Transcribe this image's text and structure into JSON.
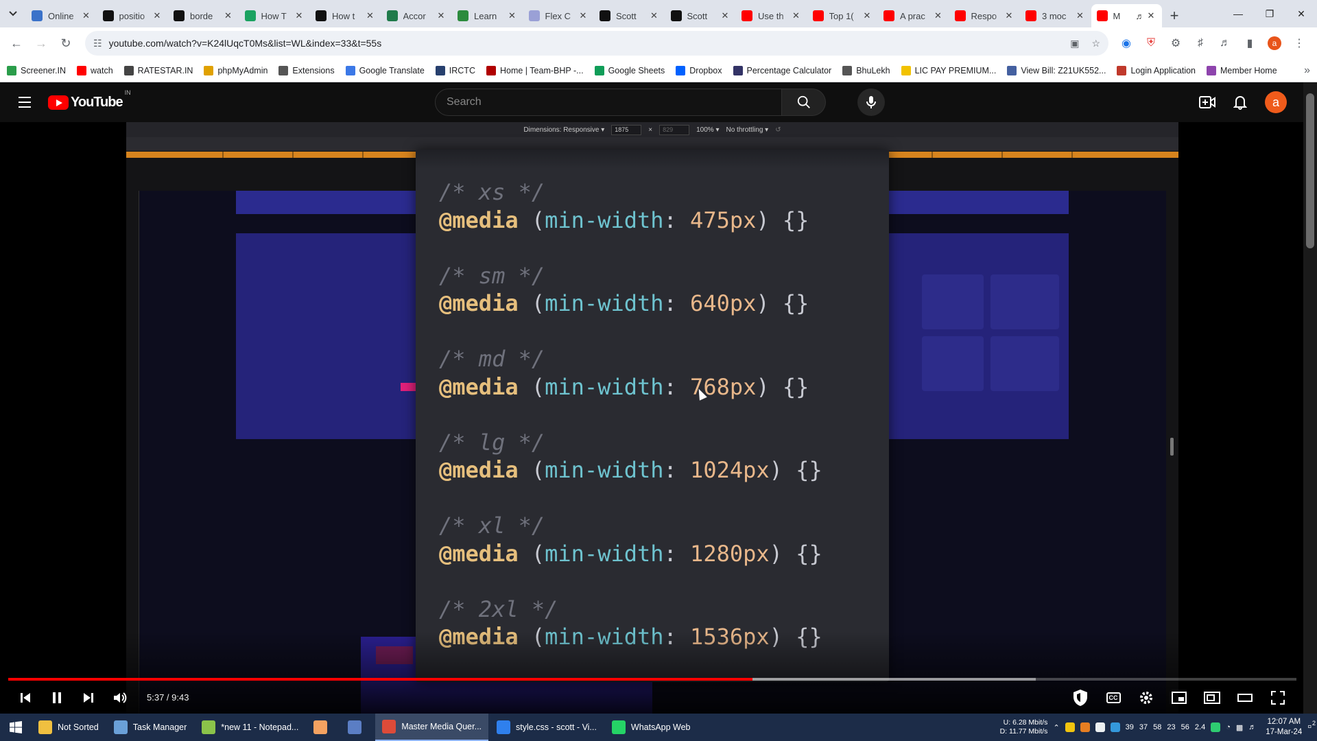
{
  "browser": {
    "tabs": [
      {
        "title": "Online",
        "color": "#3b72c9"
      },
      {
        "title": "positio",
        "color": "#111111"
      },
      {
        "title": "borde",
        "color": "#111111"
      },
      {
        "title": "How T",
        "color": "#1aa260"
      },
      {
        "title": "How t",
        "color": "#111111"
      },
      {
        "title": "Accor",
        "color": "#1f7a4a"
      },
      {
        "title": "Learn",
        "color": "#2c8b3e"
      },
      {
        "title": "Flex C",
        "color": "#9aa0d6"
      },
      {
        "title": "Scott",
        "color": "#111111"
      },
      {
        "title": "Scott",
        "color": "#111111"
      },
      {
        "title": "Use th",
        "color": "#ff0000"
      },
      {
        "title": "Top 1(",
        "color": "#ff0000"
      },
      {
        "title": "A prac",
        "color": "#ff0000"
      },
      {
        "title": "Respo",
        "color": "#ff0000"
      },
      {
        "title": "3 moc",
        "color": "#ff0000"
      },
      {
        "title": "M",
        "color": "#ff0000"
      }
    ],
    "url": "youtube.com/watch?v=K24lUqcT0Ms&list=WL&index=33&t=55s",
    "bookmarks": [
      {
        "label": "Screener.IN",
        "color": "#2a9d4a"
      },
      {
        "label": "watch",
        "color": "#ff0000"
      },
      {
        "label": "RATESTAR.IN",
        "color": "#444444"
      },
      {
        "label": "phpMyAdmin",
        "color": "#e0a100"
      },
      {
        "label": "Extensions",
        "color": "#555555"
      },
      {
        "label": "Google Translate",
        "color": "#3b78e7"
      },
      {
        "label": "IRCTC",
        "color": "#27406e"
      },
      {
        "label": "Home | Team-BHP -...",
        "color": "#b00000"
      },
      {
        "label": "Google Sheets",
        "color": "#0f9d58"
      },
      {
        "label": "Dropbox",
        "color": "#0061fe"
      },
      {
        "label": "Percentage Calculator",
        "color": "#333366"
      },
      {
        "label": "BhuLekh",
        "color": "#555555"
      },
      {
        "label": "LIC PAY PREMIUM...",
        "color": "#f2c200"
      },
      {
        "label": "View Bill: Z21UK552...",
        "color": "#4460a0"
      },
      {
        "label": "Login Application",
        "color": "#c0392b"
      },
      {
        "label": "Member Home",
        "color": "#8e44ad"
      }
    ]
  },
  "youtube": {
    "region": "IN",
    "logo_text": "YouTube",
    "search_placeholder": "Search",
    "avatar_letter": "a"
  },
  "video": {
    "devtools": {
      "dimensions_label": "Dimensions: Responsive ▾",
      "width": "1875",
      "times": "×",
      "height": "829",
      "zoom": "100% ▾",
      "throttle": "No throttling ▾"
    },
    "code_blocks": [
      {
        "comment": "/* xs */",
        "at": "@media",
        "open": " (",
        "prop": "min-width",
        "colon": ": ",
        "value": "475px",
        "close": ") {}"
      },
      {
        "comment": "/* sm */",
        "at": "@media",
        "open": " (",
        "prop": "min-width",
        "colon": ": ",
        "value": "640px",
        "close": ") {}"
      },
      {
        "comment": "/* md */",
        "at": "@media",
        "open": " (",
        "prop": "min-width",
        "colon": ": ",
        "value": "768px",
        "close": ") {}"
      },
      {
        "comment": "/* lg */",
        "at": "@media",
        "open": " (",
        "prop": "min-width",
        "colon": ": ",
        "value": "1024px",
        "close": ") {}"
      },
      {
        "comment": "/* xl */",
        "at": "@media",
        "open": " (",
        "prop": "min-width",
        "colon": ": ",
        "value": "1280px",
        "close": ") {}"
      },
      {
        "comment": "/* 2xl */",
        "at": "@media",
        "open": " (",
        "prop": "min-width",
        "colon": ": ",
        "value": "1536px",
        "close": ") {}"
      }
    ],
    "time_display": "5:37 / 9:43",
    "played_fraction": 0.578
  },
  "taskbar": {
    "items": [
      {
        "label": "Not Sorted",
        "color": "#f0c040"
      },
      {
        "label": "Task Manager",
        "color": "#6aa0d8"
      },
      {
        "label": "*new 11 - Notepad...",
        "color": "#8bc34a"
      },
      {
        "label": "",
        "color": "#f4a261"
      },
      {
        "label": "",
        "color": "#5b7ec4"
      },
      {
        "label": "Master Media Quer...",
        "color": "#dd4b39"
      },
      {
        "label": "style.css - scott - Vi...",
        "color": "#2f80ed"
      },
      {
        "label": "WhatsApp Web",
        "color": "#25d366"
      }
    ],
    "net_up": "U:     6.28 Mbit/s",
    "net_down": "D:   11.77 Mbit/s",
    "tray_numbers": [
      "39",
      "37",
      "58",
      "23",
      "56",
      "2.4"
    ],
    "time": "12:07 AM",
    "date": "17-Mar-24",
    "notification_count": "2"
  }
}
